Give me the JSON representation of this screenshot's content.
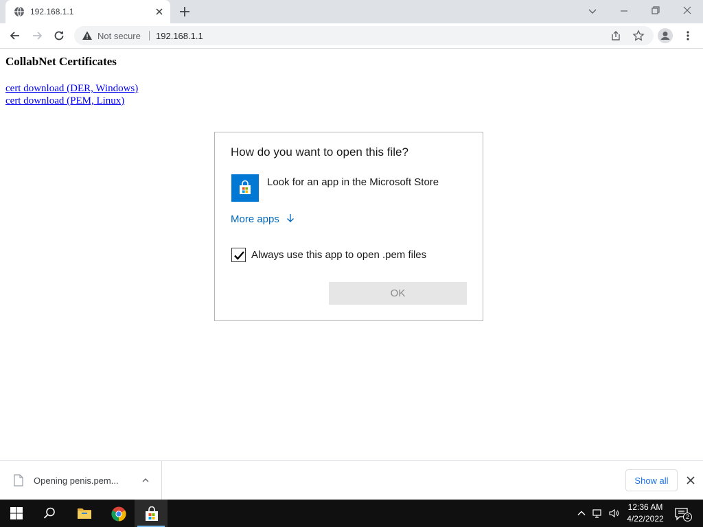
{
  "browser": {
    "tab": {
      "title": "192.168.1.1"
    },
    "omnibox": {
      "security_label": "Not secure",
      "url": "192.168.1.1"
    }
  },
  "page": {
    "title": "CollabNet Certificates",
    "links": [
      {
        "label": "cert download (DER, Windows)"
      },
      {
        "label": "cert download (PEM, Linux)"
      }
    ]
  },
  "dialog": {
    "title": "How do you want to open this file?",
    "app_option": {
      "label": "Look for an app in the Microsoft Store",
      "icon": "microsoft-store-icon"
    },
    "more_apps": "More apps",
    "checkbox": {
      "label": "Always use this app to open .pem files",
      "checked": true
    },
    "ok_label": "OK"
  },
  "download_shelf": {
    "item": {
      "text": "Opening penis.pem..."
    },
    "show_all": "Show all"
  },
  "taskbar": {
    "pinned": [
      "start-icon",
      "search-icon",
      "file-explorer-icon",
      "chrome-icon",
      "microsoft-store-icon"
    ],
    "clock": {
      "time": "12:36 AM",
      "date": "4/22/2022"
    },
    "notifications": {
      "count": "2"
    }
  },
  "colors": {
    "accent": "#0078d4",
    "link": "#0000ee",
    "dialog_link": "#0067b8",
    "taskbar": "#101010",
    "tab_strip": "#dee1e6"
  }
}
